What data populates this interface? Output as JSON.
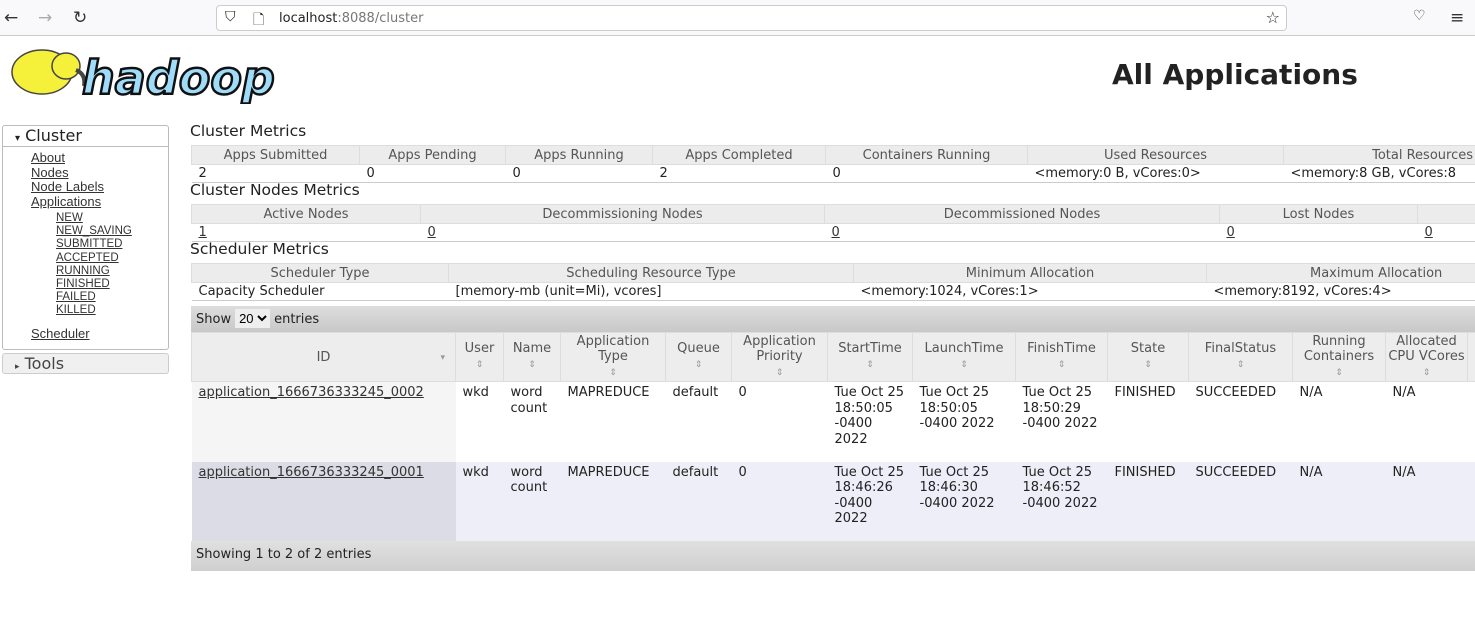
{
  "browser": {
    "url_host": "localhost",
    "url_rest": ":8088/cluster"
  },
  "logo_text": "hadoop",
  "page_title": "All Applications",
  "sidebar": {
    "cluster": "Cluster",
    "links": [
      "About",
      "Nodes",
      "Node Labels",
      "Applications"
    ],
    "states": [
      "NEW",
      "NEW_SAVING",
      "SUBMITTED",
      "ACCEPTED",
      "RUNNING",
      "FINISHED",
      "FAILED",
      "KILLED"
    ],
    "scheduler": "Scheduler",
    "tools": "Tools"
  },
  "cluster_metrics": {
    "title": "Cluster Metrics",
    "headers": [
      "Apps Submitted",
      "Apps Pending",
      "Apps Running",
      "Apps Completed",
      "Containers Running",
      "Used Resources",
      "Total Resources"
    ],
    "values": [
      "2",
      "0",
      "0",
      "2",
      "0",
      "<memory:0 B, vCores:0>",
      "<memory:8 GB, vCores:8"
    ]
  },
  "nodes_metrics": {
    "title": "Cluster Nodes Metrics",
    "headers": [
      "Active Nodes",
      "Decommissioning Nodes",
      "Decommissioned Nodes",
      "Lost Nodes",
      ""
    ],
    "values": [
      "1",
      "0",
      "0",
      "0",
      "0"
    ]
  },
  "scheduler_metrics": {
    "title": "Scheduler Metrics",
    "headers": [
      "Scheduler Type",
      "Scheduling Resource Type",
      "Minimum Allocation",
      "Maximum Allocation"
    ],
    "values": [
      "Capacity Scheduler",
      "[memory-mb (unit=Mi), vcores]",
      "<memory:1024, vCores:1>",
      "<memory:8192, vCores:4>"
    ]
  },
  "show": {
    "before": "Show",
    "value": "20",
    "after": "entries"
  },
  "apps": {
    "headers": [
      "ID",
      "User",
      "Name",
      "Application Type",
      "Queue",
      "Application Priority",
      "StartTime",
      "LaunchTime",
      "FinishTime",
      "State",
      "FinalStatus",
      "Running Containers",
      "Allocated CPU VCores",
      ""
    ],
    "rows": [
      [
        "application_1666736333245_0002",
        "wkd",
        "word count",
        "MAPREDUCE",
        "default",
        "0",
        "Tue Oct 25 18:50:05 -0400 2022",
        "Tue Oct 25 18:50:05 -0400 2022",
        "Tue Oct 25 18:50:29 -0400 2022",
        "FINISHED",
        "SUCCEEDED",
        "N/A",
        "N/A",
        ""
      ],
      [
        "application_1666736333245_0001",
        "wkd",
        "word count",
        "MAPREDUCE",
        "default",
        "0",
        "Tue Oct 25 18:46:26 -0400 2022",
        "Tue Oct 25 18:46:30 -0400 2022",
        "Tue Oct 25 18:46:52 -0400 2022",
        "FINISHED",
        "SUCCEEDED",
        "N/A",
        "N/A",
        ""
      ]
    ]
  },
  "footer": "Showing 1 to 2 of 2 entries"
}
